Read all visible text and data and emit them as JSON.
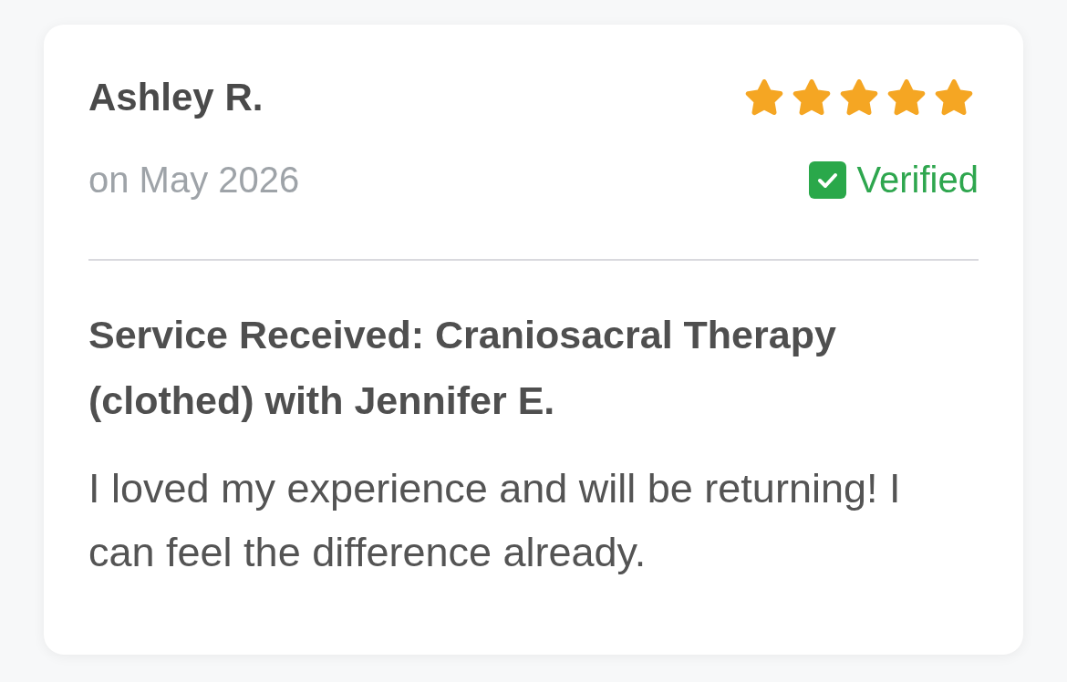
{
  "review": {
    "author": "Ashley R.",
    "stars": 5,
    "date": "on May 2026",
    "verified": {
      "label": "Verified"
    },
    "service": "Service Received: Craniosacral Therapy (clothed) with Jennifer E.",
    "body": "I loved my experience and will be returning! I can feel the difference already."
  }
}
